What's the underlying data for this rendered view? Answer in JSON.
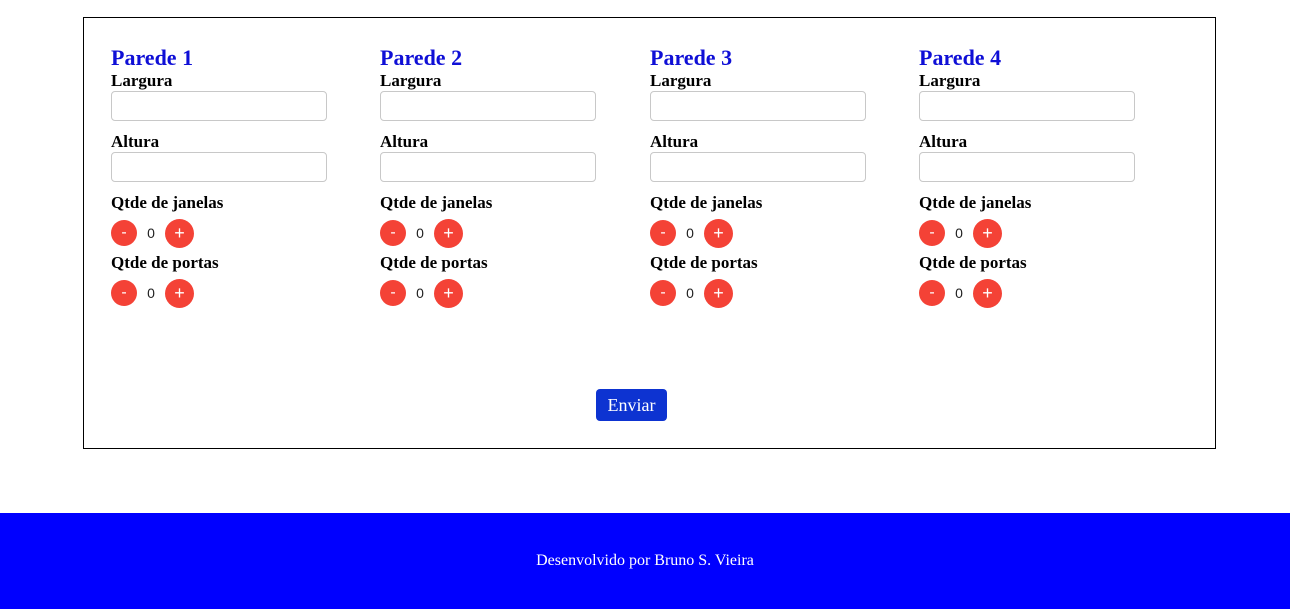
{
  "walls": [
    {
      "title": "Parede 1",
      "width_label": "Largura",
      "height_label": "Altura",
      "windows_label": "Qtde de janelas",
      "windows_value": "0",
      "doors_label": "Qtde de portas",
      "doors_value": "0"
    },
    {
      "title": "Parede 2",
      "width_label": "Largura",
      "height_label": "Altura",
      "windows_label": "Qtde de janelas",
      "windows_value": "0",
      "doors_label": "Qtde de portas",
      "doors_value": "0"
    },
    {
      "title": "Parede 3",
      "width_label": "Largura",
      "height_label": "Altura",
      "windows_label": "Qtde de janelas",
      "windows_value": "0",
      "doors_label": "Qtde de portas",
      "doors_value": "0"
    },
    {
      "title": "Parede 4",
      "width_label": "Largura",
      "height_label": "Altura",
      "windows_label": "Qtde de janelas",
      "windows_value": "0",
      "doors_label": "Qtde de portas",
      "doors_value": "0"
    }
  ],
  "stepper": {
    "minus": "-",
    "plus": "+"
  },
  "form": {
    "submit_label": "Enviar"
  },
  "footer": {
    "text": "Desenvolvido por Bruno S. Vieira"
  },
  "colors": {
    "title": "#0f0fd6",
    "stepper": "#f44236",
    "submit": "#0d33d1",
    "footer": "#0000ff"
  }
}
